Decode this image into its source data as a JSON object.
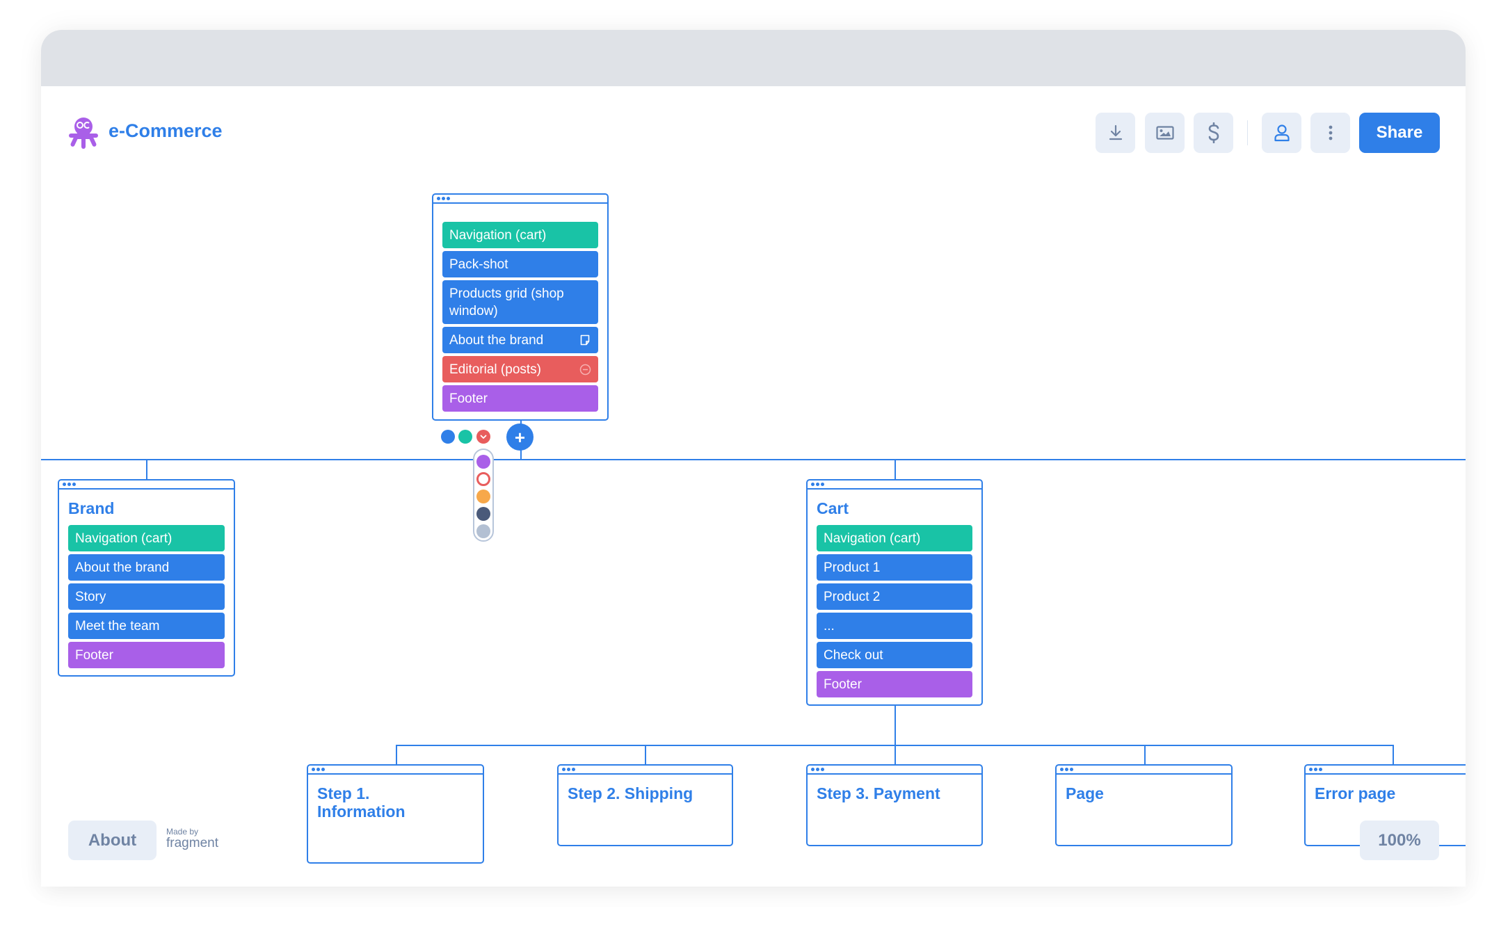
{
  "app": {
    "title": "e-Commerce",
    "logo_icon": "octopus-logo-icon"
  },
  "toolbar": {
    "buttons": [
      {
        "name": "download",
        "icon": "download-icon"
      },
      {
        "name": "export-image",
        "icon": "image-icon"
      },
      {
        "name": "pricing",
        "icon": "dollar-icon"
      },
      {
        "name": "account",
        "icon": "user-icon"
      },
      {
        "name": "more",
        "icon": "more-vertical-icon"
      }
    ],
    "share_label": "Share"
  },
  "colors": {
    "accent": "#2f7fe8",
    "teal": "#19c3a6",
    "blue": "#2f7fe8",
    "red": "#e85d5d",
    "purple": "#a95fe8",
    "orange": "#f7a84a",
    "navy": "#4a5a7a",
    "gray": "#b3c0d3"
  },
  "home_card": {
    "rows": [
      {
        "label": "Navigation (cart)",
        "color": "#19c3a6"
      },
      {
        "label": "Pack-shot",
        "color": "#2f7fe8"
      },
      {
        "label": "Products grid (shop window)",
        "color": "#2f7fe8"
      },
      {
        "label": "About the brand",
        "color": "#2f7fe8",
        "icon": "note-icon"
      },
      {
        "label": "Editorial (posts)",
        "color": "#e85d5d",
        "icon": "minus-circle-icon"
      },
      {
        "label": "Footer",
        "color": "#a95fe8"
      }
    ],
    "color_picker": {
      "quick": [
        "#2f7fe8",
        "#19c3a6",
        "#e85d5d"
      ],
      "palette": [
        "#a95fe8",
        "#e85d5d",
        "#f7a84a",
        "#4a5a7a",
        "#b3c0d3"
      ],
      "selected": "#e85d5d"
    },
    "add_label": "+"
  },
  "brand_card": {
    "title": "Brand",
    "rows": [
      {
        "label": "Navigation (cart)",
        "color": "#19c3a6"
      },
      {
        "label": "About the brand",
        "color": "#2f7fe8"
      },
      {
        "label": "Story",
        "color": "#2f7fe8"
      },
      {
        "label": "Meet the team",
        "color": "#2f7fe8"
      },
      {
        "label": "Footer",
        "color": "#a95fe8"
      }
    ]
  },
  "cart_card": {
    "title": "Cart",
    "rows": [
      {
        "label": "Navigation (cart)",
        "color": "#19c3a6"
      },
      {
        "label": "Product 1",
        "color": "#2f7fe8"
      },
      {
        "label": "Product 2",
        "color": "#2f7fe8"
      },
      {
        "label": "...",
        "color": "#2f7fe8"
      },
      {
        "label": "Check out",
        "color": "#2f7fe8"
      },
      {
        "label": "Footer",
        "color": "#a95fe8"
      }
    ]
  },
  "sub_pages": [
    {
      "title": "Step 1. Information"
    },
    {
      "title": "Step 2. Shipping"
    },
    {
      "title": "Step 3. Payment"
    },
    {
      "title": "Page"
    },
    {
      "title": "Error page"
    }
  ],
  "footer": {
    "about_label": "About",
    "made_by_small": "Made by",
    "made_by_brand": "fragment",
    "zoom_level": "100%"
  }
}
